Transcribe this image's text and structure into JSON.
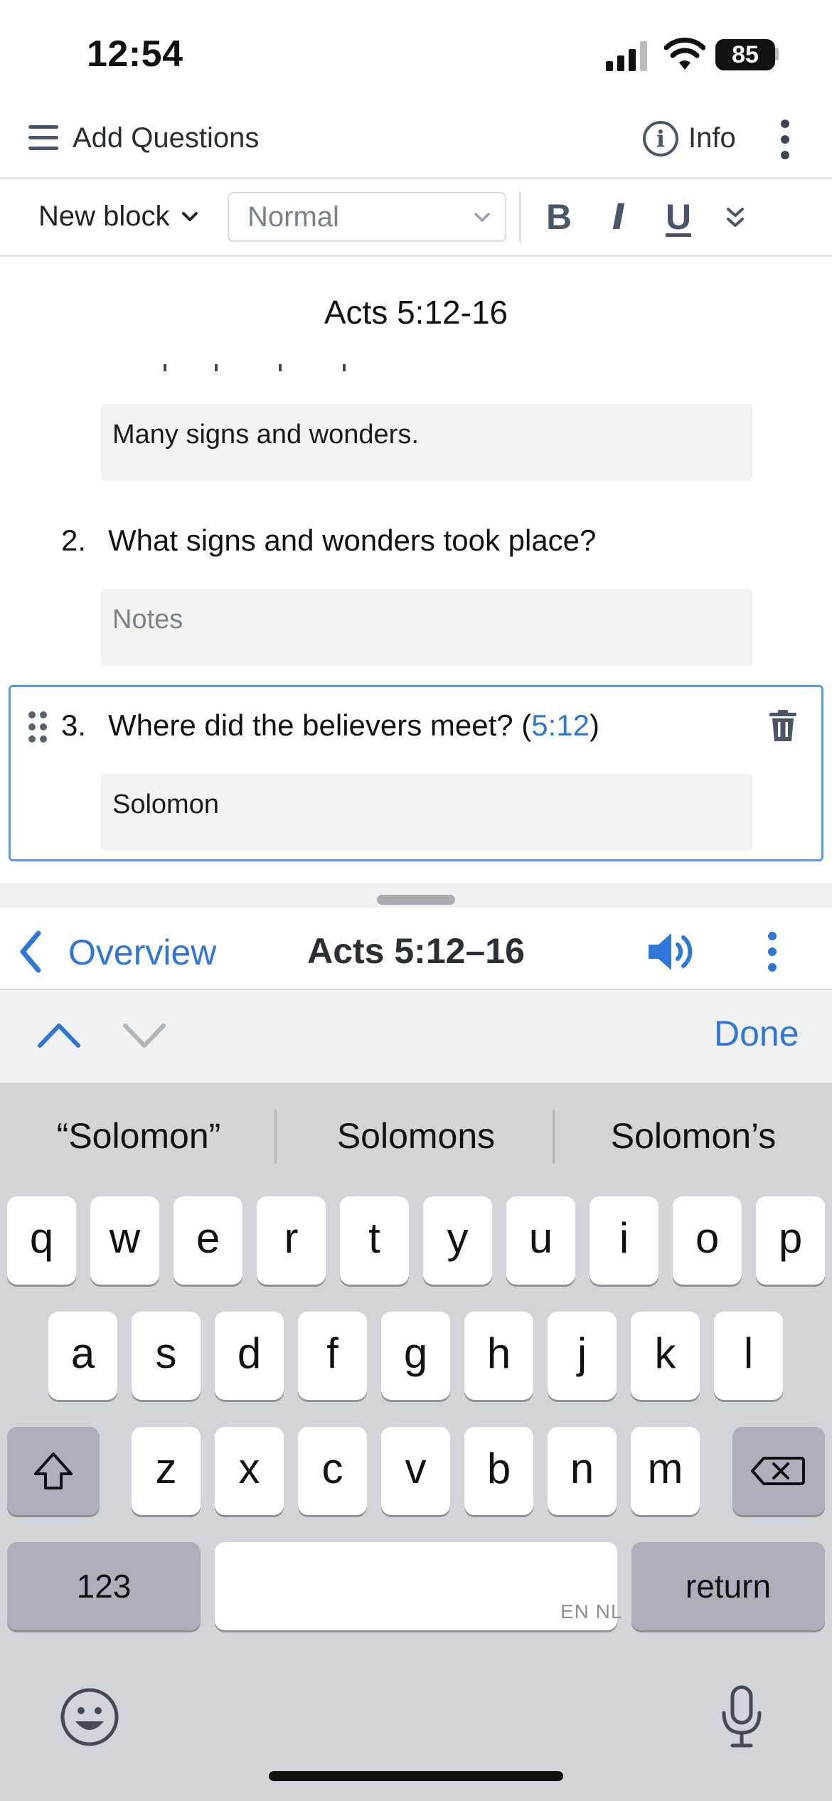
{
  "status_bar": {
    "time": "12:54",
    "battery": "85"
  },
  "app_bar": {
    "title": "Add Questions",
    "info_label": "Info"
  },
  "toolbar": {
    "block_type": "New block",
    "text_style": "Normal",
    "bold_label": "B",
    "italic_label": "I",
    "underline_label": "U"
  },
  "document": {
    "title": "Acts 5:12-16",
    "first_answer": "Many signs and wonders.",
    "questions": [
      {
        "number": "2.",
        "text": "What signs and wonders took place?",
        "answer_placeholder": "Notes",
        "answer": ""
      },
      {
        "number": "3.",
        "text": "Where did the believers meet? (",
        "reference": "5:12",
        "text_end": ")",
        "answer": "Solomon"
      }
    ]
  },
  "reader_bar": {
    "back_label": "Overview",
    "passage": "Acts 5:12–16"
  },
  "accessory": {
    "done_label": "Done"
  },
  "keyboard": {
    "suggestions": [
      "“Solomon”",
      "Solomons",
      "Solomon’s"
    ],
    "row1": [
      "q",
      "w",
      "e",
      "r",
      "t",
      "y",
      "u",
      "i",
      "o",
      "p"
    ],
    "row2": [
      "a",
      "s",
      "d",
      "f",
      "g",
      "h",
      "j",
      "k",
      "l"
    ],
    "row3": [
      "z",
      "x",
      "c",
      "v",
      "b",
      "n",
      "m"
    ],
    "numbers_label": "123",
    "return_label": "return",
    "languages_label": "EN NL"
  },
  "colors": {
    "accent": "#2f76d6",
    "selection_border": "#5b9be6",
    "icon_gray": "#4a5668"
  },
  "icons": [
    "menu-icon",
    "info-icon",
    "more-vert-icon",
    "chevron-down-icon",
    "drag-handle-icon",
    "trash-icon",
    "chevron-left-icon",
    "speaker-icon",
    "chevron-up-icon",
    "shift-icon",
    "backspace-icon",
    "emoji-icon",
    "microphone-icon"
  ]
}
